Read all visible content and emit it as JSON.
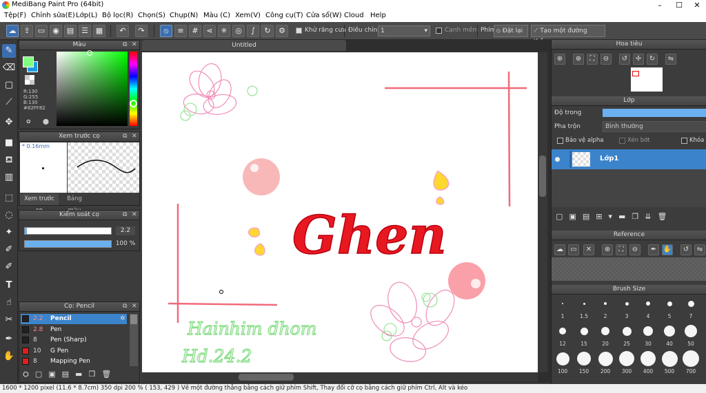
{
  "window": {
    "title": "MediBang Paint Pro (64bit)",
    "minimize": "–",
    "maximize": "☐",
    "close": "✕"
  },
  "menu": [
    "Tệp(F)",
    "Chỉnh sửa(E)",
    "Lớp(L)",
    "Bộ lọc(R)",
    "Chọn(S)",
    "Chụp(N)",
    "Màu (C)",
    "Xem(V)",
    "Công cụ(T)",
    "Cửa sổ(W)",
    "Cloud",
    "Help"
  ],
  "toolbar": {
    "antialias_label": "Khử răng cưa",
    "correction_label": "Điều chỉnh",
    "correction_value": "1",
    "edge_label": "Cạnh mềm",
    "key_label": "Phím",
    "reset_label": "Đặt lại",
    "line_label": "Tạo một đường thẳng"
  },
  "color_panel": {
    "title": "Màu",
    "r": "R:130",
    "g": "G:255",
    "b": "B:130",
    "hex": "#82FF82",
    "foreground": "#82ff82",
    "background": "#1e9be0"
  },
  "brush_preview": {
    "title": "Xem trước cọ",
    "size": "* 0.16mm",
    "tab1": "Xem trước cọ",
    "tab2": "Bảng màu"
  },
  "brush_control": {
    "title": "Kiểm soát cọ",
    "size_value": "2.2",
    "opacity_value": "100 %",
    "size_fraction": 0.02,
    "opacity_fraction": 1.0
  },
  "brush_list": {
    "title": "Cọ: Pencil",
    "items": [
      {
        "size": "2.2",
        "name": "Pencil",
        "color": "#222222",
        "selected": true
      },
      {
        "size": "2.8",
        "name": "Pen",
        "color": "#222222",
        "selected": false
      },
      {
        "size": "8",
        "name": "Pen (Sharp)",
        "color": "#222222",
        "selected": false
      },
      {
        "size": "10",
        "name": "G Pen",
        "color": "#e02020",
        "selected": false
      },
      {
        "size": "8",
        "name": "Mapping Pen",
        "color": "#e02020",
        "selected": false
      }
    ]
  },
  "canvas": {
    "tab": "Untitled"
  },
  "navigator": {
    "title": "Hoa tiêu"
  },
  "layer_panel": {
    "title": "Lớp",
    "opacity_label": "Độ trong",
    "blend_label": "Pha trộn",
    "blend_value": "Bình thường",
    "protect_alpha": "Bảo vệ alpha",
    "clipping": "Xén bớt",
    "lock": "Khóa",
    "layer_name": "Lớp1"
  },
  "reference": {
    "title": "Reference"
  },
  "brush_size": {
    "title": "Brush Size",
    "sizes": [
      "1",
      "1.5",
      "2",
      "3",
      "4",
      "5",
      "7",
      "12",
      "15",
      "20",
      "25",
      "30",
      "40",
      "50",
      "100",
      "150",
      "200",
      "300",
      "400",
      "500",
      "700"
    ]
  },
  "status": "1600 * 1200 pixel   (11.6 * 8.7cm)   350 dpi   200 %   ( 153, 429 )   Vẽ một đường thẳng bằng cách giữ phím Shift, Thay đổi cỡ cọ bằng cách giữ phím Ctrl, Alt và kéo",
  "drawing": {
    "word": "Ghen",
    "handwriting_line1": "Hainhim dhom",
    "handwriting_line2": "Hd.24.2"
  }
}
